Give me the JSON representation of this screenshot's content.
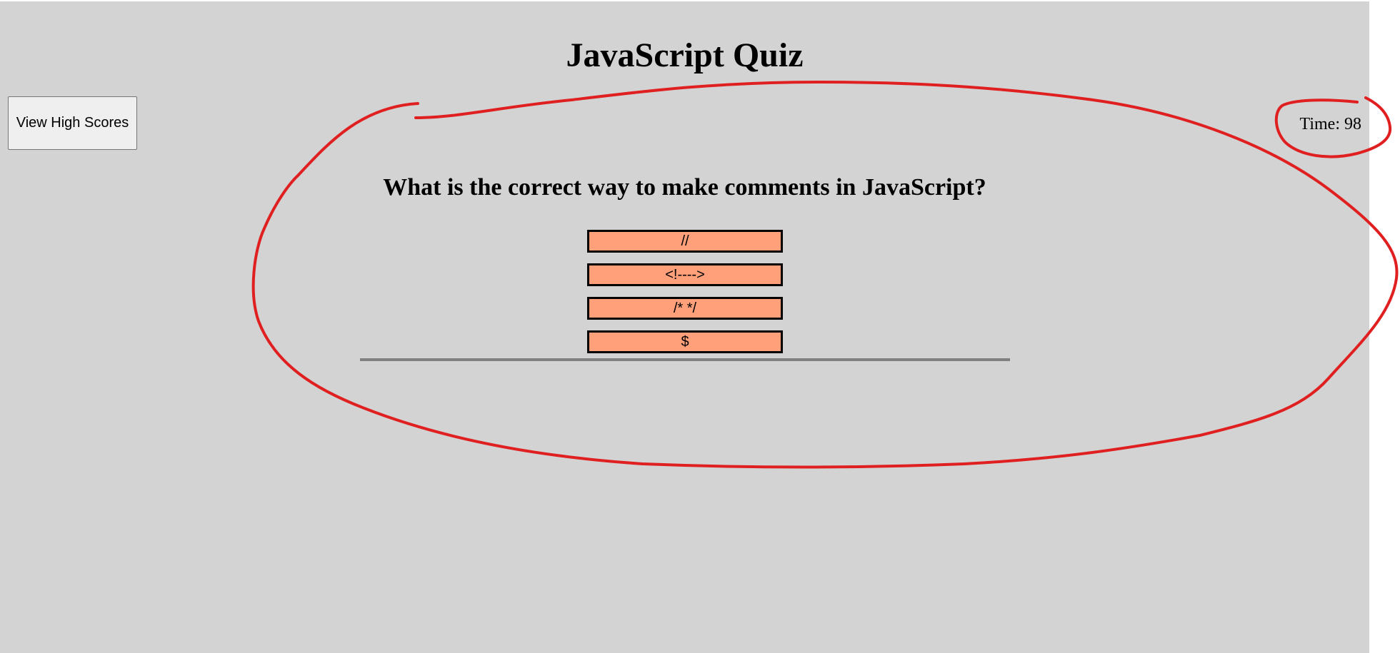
{
  "app": {
    "title": "JavaScript Quiz",
    "high_scores_label": "View High Scores",
    "timer_text": "Time: 98"
  },
  "quiz": {
    "question": "What is the correct way to make comments in JavaScript?",
    "answers": [
      {
        "label": "//"
      },
      {
        "label": "<!---->"
      },
      {
        "label": "/* */"
      },
      {
        "label": "$"
      }
    ]
  },
  "colors": {
    "background": "#d3d3d3",
    "answer_fill": "#ffa07a",
    "divider": "#808080",
    "annotation_stroke": "#e02020"
  }
}
